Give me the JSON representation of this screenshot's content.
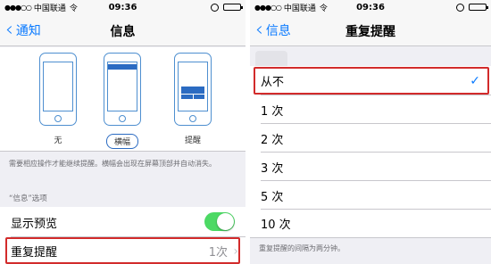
{
  "left_screen": {
    "status_bar": {
      "signal": "●●●○○",
      "carrier": "中国联通",
      "wifi": "令",
      "time": "09:36",
      "lock": "⊙"
    },
    "nav": {
      "back_label": "通知",
      "title": "信息"
    },
    "alert_styles": [
      {
        "label": "无",
        "selected": false
      },
      {
        "label": "横幅",
        "selected": true
      },
      {
        "label": "提醒",
        "selected": false
      }
    ],
    "style_note": "需要相应操作才能继续提醒。横幅会出现在屏幕顶部并自动消失。",
    "section_header": "“信息”选项",
    "show_preview": {
      "label": "显示预览",
      "enabled": true
    },
    "repeat_alerts": {
      "label": "重复提醒",
      "value": "1次"
    }
  },
  "right_screen": {
    "status_bar": {
      "signal": "●●●○○",
      "carrier": "中国联通",
      "wifi": "令",
      "time": "09:36",
      "lock": "⊙"
    },
    "nav": {
      "back_label": "信息",
      "title": "重复提醒"
    },
    "options": [
      {
        "label": "从不",
        "selected": true
      },
      {
        "label": "1 次",
        "selected": false
      },
      {
        "label": "2 次",
        "selected": false
      },
      {
        "label": "3 次",
        "selected": false
      },
      {
        "label": "5 次",
        "selected": false
      },
      {
        "label": "10 次",
        "selected": false
      }
    ],
    "check_mark": "✓",
    "footer_note": "重复提醒的间隔为两分钟。"
  },
  "colors": {
    "accent": "#0a7aff",
    "toggle_on": "#4cd964",
    "highlight": "#d22b2b",
    "phone_blue": "#2b6bc2"
  }
}
